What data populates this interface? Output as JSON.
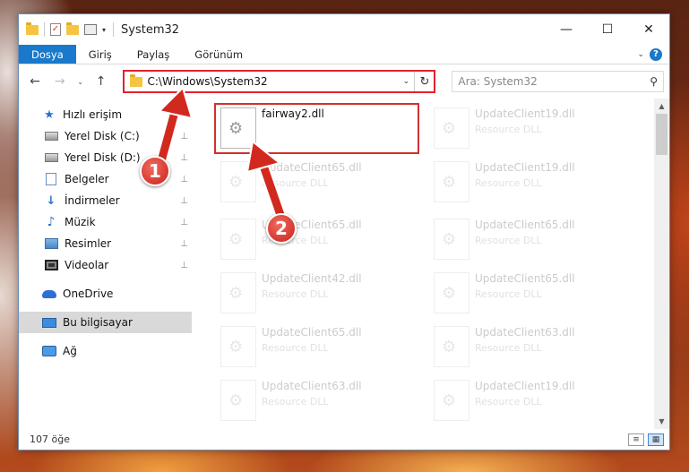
{
  "window": {
    "title": "System32",
    "controls": {
      "minimize": "—",
      "maximize": "☐",
      "close": "✕"
    }
  },
  "ribbon": {
    "tabs": [
      {
        "label": "Dosya",
        "active": true
      },
      {
        "label": "Giriş",
        "active": false
      },
      {
        "label": "Paylaş",
        "active": false
      },
      {
        "label": "Görünüm",
        "active": false
      }
    ],
    "help": "?"
  },
  "navbar": {
    "back": "←",
    "forward": "→",
    "recent": "⌄",
    "up": "↑",
    "address": "C:\\Windows\\System32",
    "refresh": "↻",
    "search_placeholder": "Ara: System32",
    "search_icon": "⚲"
  },
  "sidebar": {
    "items": [
      {
        "label": "Hızlı erişim",
        "icon": "star-icon",
        "pinned": false
      },
      {
        "label": "Yerel Disk (C:)",
        "icon": "drive-icon",
        "pinned": true
      },
      {
        "label": "Yerel Disk (D:)",
        "icon": "drive-icon",
        "pinned": true
      },
      {
        "label": "Belgeler",
        "icon": "document-icon",
        "pinned": true
      },
      {
        "label": "İndirmeler",
        "icon": "download-icon",
        "pinned": true
      },
      {
        "label": "Müzik",
        "icon": "music-icon",
        "pinned": true
      },
      {
        "label": "Resimler",
        "icon": "pictures-icon",
        "pinned": true
      },
      {
        "label": "Videolar",
        "icon": "video-icon",
        "pinned": true
      },
      {
        "label": "OneDrive",
        "icon": "onedrive-icon",
        "pinned": false
      },
      {
        "label": "Bu bilgisayar",
        "icon": "computer-icon",
        "pinned": false,
        "selected": true
      },
      {
        "label": "Ağ",
        "icon": "network-icon",
        "pinned": false
      }
    ],
    "pin_glyph": "📌"
  },
  "files": {
    "selected": {
      "name": "fairway2.dll",
      "type": ""
    },
    "column_left": [
      {
        "name": "UpdateClient65.dll",
        "type": "Resource DLL"
      },
      {
        "name": "UpdateClient65.dll",
        "type": "Resource DLL"
      },
      {
        "name": "UpdateClient42.dll",
        "type": "Resource DLL"
      },
      {
        "name": "UpdateClient65.dll",
        "type": "Resource DLL"
      },
      {
        "name": "UpdateClient63.dll",
        "type": "Resource DLL"
      }
    ],
    "column_right": [
      {
        "name": "UpdateClient19.dll",
        "type": "Resource DLL"
      },
      {
        "name": "UpdateClient19.dll",
        "type": "Resource DLL"
      },
      {
        "name": "UpdateClient65.dll",
        "type": "Resource DLL"
      },
      {
        "name": "UpdateClient65.dll",
        "type": "Resource DLL"
      },
      {
        "name": "UpdateClient63.dll",
        "type": "Resource DLL"
      },
      {
        "name": "UpdateClient19.dll",
        "type": "Resource DLL"
      }
    ]
  },
  "status": {
    "count": "107 öğe"
  },
  "annotations": {
    "step1": "1",
    "step2": "2"
  },
  "colors": {
    "accent": "#1979ca",
    "highlight": "#d1302f",
    "badge": "#c8221a"
  }
}
